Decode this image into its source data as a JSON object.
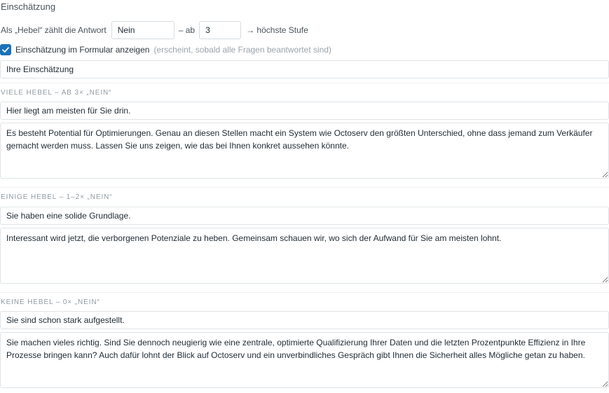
{
  "section_title": "Einschätzung",
  "hebel_row": {
    "prefix_label": "Als „Hebel“ zählt die Antwort",
    "answer_value": "Nein",
    "middle_label": "– ab",
    "threshold_value": "3",
    "suffix_label": "→ höchste Stufe"
  },
  "show_in_form": {
    "checked": true,
    "label": "Einschätzung im Formular anzeigen",
    "hint": "(erscheint, sobald alle Fragen beantwortet sind)"
  },
  "assessment_heading": "Ihre Einschätzung",
  "groups": [
    {
      "label": "Viele Hebel – ab 3× „Nein“",
      "title": "Hier liegt am meisten für Sie drin.",
      "text": "Es besteht Potential für Optimierungen. Genau an diesen Stellen macht ein System wie Octoserv den größten Unterschied, ohne dass jemand zum Verkäufer gemacht werden muss. Lassen Sie uns zeigen, wie das bei Ihnen konkret aussehen könnte."
    },
    {
      "label": "Einige Hebel – 1–2× „Nein“",
      "title": "Sie haben eine solide Grundlage.",
      "text": "Interessant wird jetzt, die verborgenen Potenziale zu heben. Gemeinsam schauen wir, wo sich der Aufwand für Sie am meisten lohnt."
    },
    {
      "label": "Keine Hebel – 0× „Nein“",
      "title": "Sie sind schon stark aufgestellt.",
      "text": "Sie machen vieles richtig. Sind Sie dennoch neugierig wie eine zentrale, optimierte Qualifizierung Ihrer Daten und die letzten Prozentpunkte Effizienz in Ihre Prozesse bringen kann? Auch dafür lohnt der Blick auf Octoserv und ein unverbindliches Gespräch gibt Ihnen die Sicherheit alles Mögliche getan zu haben."
    }
  ],
  "colors": {
    "accent": "#1a73b8",
    "border": "#dfe4e8",
    "muted_text": "#9aa3ab"
  }
}
